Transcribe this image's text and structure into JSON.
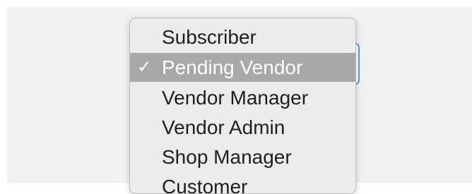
{
  "role_select": {
    "options": [
      {
        "label": "Subscriber",
        "checked": false
      },
      {
        "label": "Pending Vendor",
        "checked": true,
        "check_mark": "✓"
      },
      {
        "label": "Vendor Manager",
        "checked": false
      },
      {
        "label": "Vendor Admin",
        "checked": false
      },
      {
        "label": "Shop Manager",
        "checked": false
      },
      {
        "label": "Customer",
        "checked": false
      }
    ],
    "selected_value": "Pending Vendor"
  },
  "colors": {
    "highlight": "#a8a8a8",
    "focus_border": "#5b9dd9",
    "menu_background": "#ececec"
  }
}
